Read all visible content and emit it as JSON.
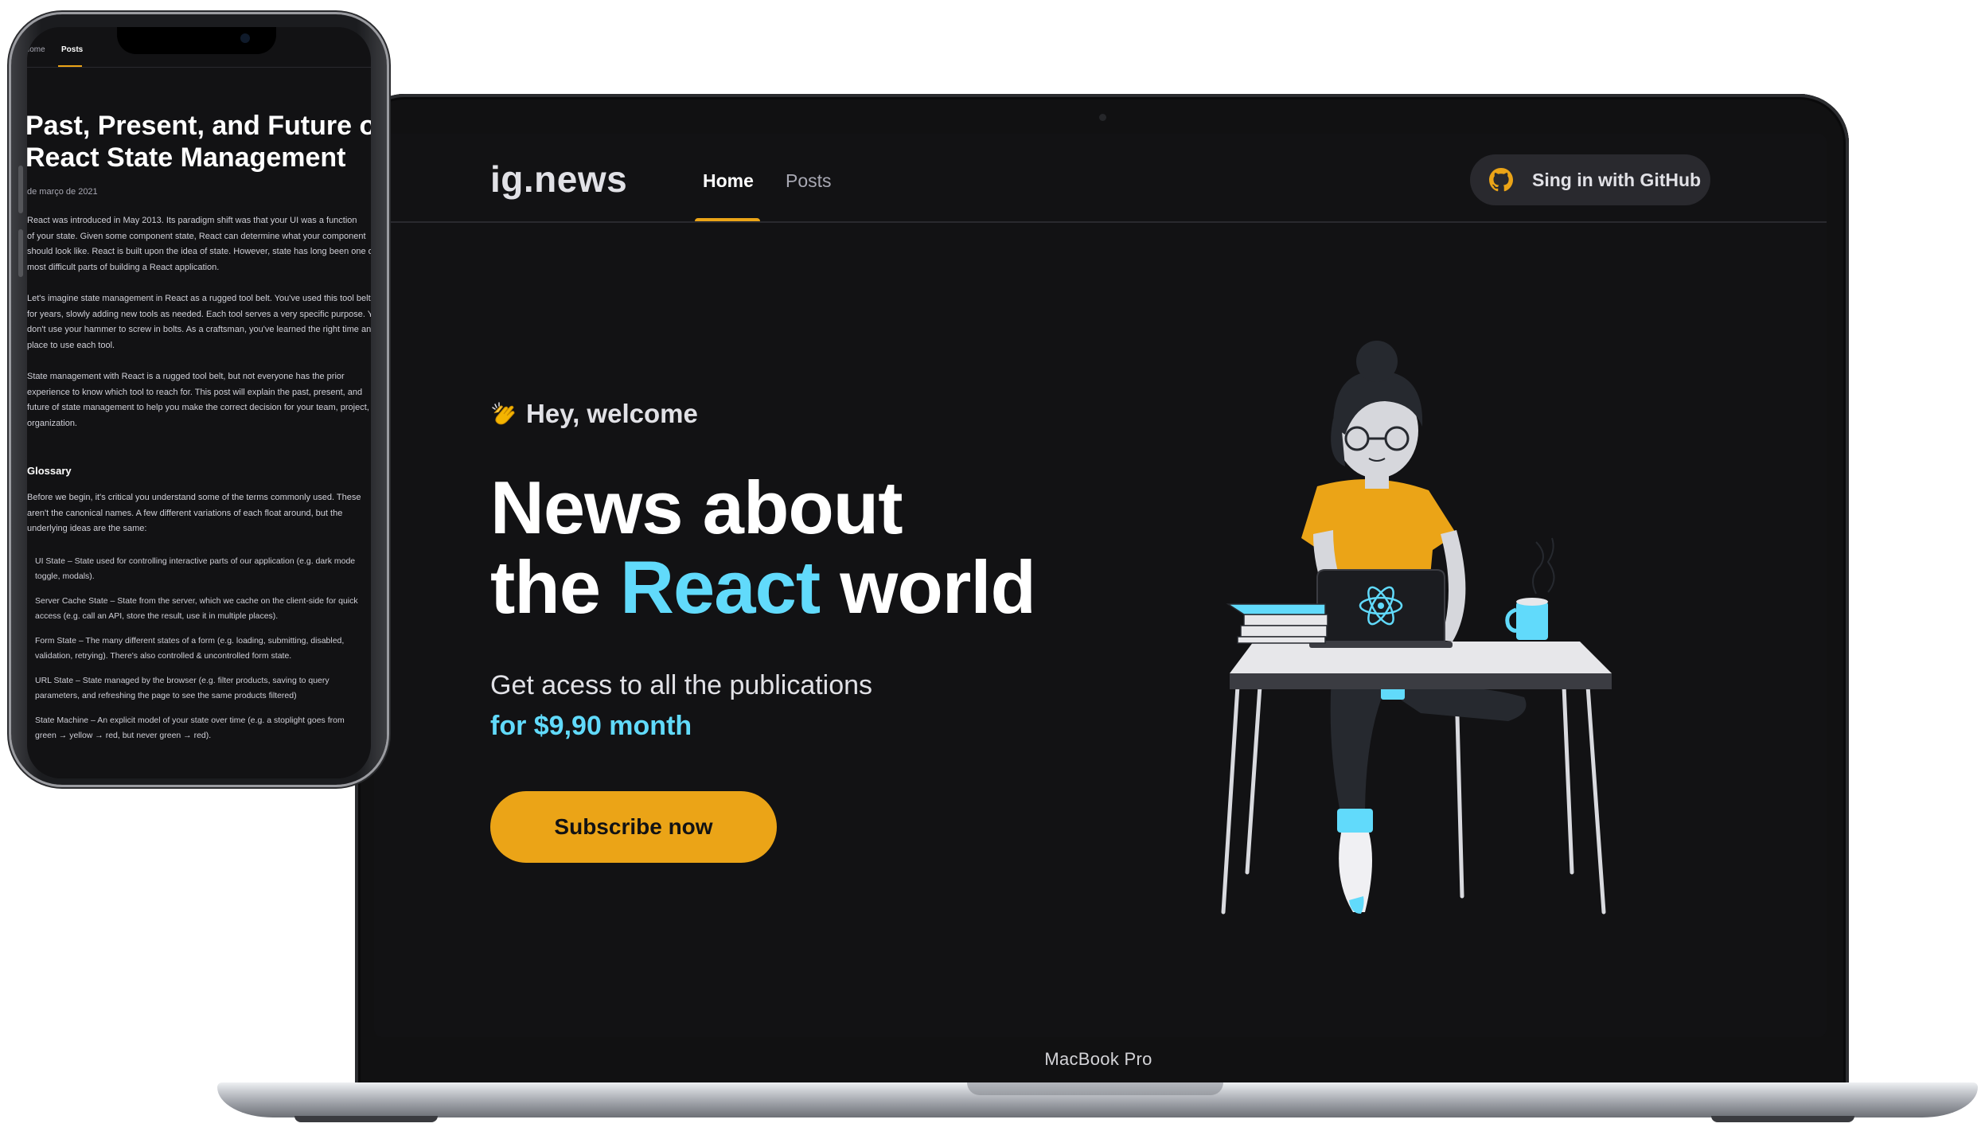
{
  "laptop": {
    "brand_label": "MacBook Pro",
    "site": {
      "logo": "ig.news",
      "nav": [
        {
          "label": "Home",
          "active": true
        },
        {
          "label": "Posts",
          "active": false
        }
      ],
      "github_button": {
        "label": "Sing in with GitHub",
        "icon": "github-icon"
      },
      "hero": {
        "greeting": "Hey, welcome",
        "greeting_icon": "clapping-hands-icon",
        "title_line1": "News about",
        "title_line2_pre": "the ",
        "title_line2_accent": "React",
        "title_line2_post": " world",
        "subtitle": "Get acess to all the publications",
        "price": "for $9,90 month",
        "cta": "Subscribe now"
      }
    }
  },
  "phone": {
    "nav": [
      {
        "label": "Home",
        "active": false
      },
      {
        "label": "Posts",
        "active": true
      }
    ],
    "post": {
      "title_line1": "Past, Present, and Future of",
      "title_line2": "React State Management",
      "date": "de março de 2021",
      "paragraphs": [
        [
          "React was introduced in May 2013. Its paradigm shift was that your UI was a function",
          "of your state. Given some component state, React can determine what your component",
          "should look like. React is built upon the idea of state. However, state has long been one of the",
          "most difficult parts of building a React application."
        ],
        [
          "Let's imagine state management in React as a rugged tool belt. You've used this tool belt",
          "for years, slowly adding new tools as needed. Each tool serves a very specific purpose. You",
          "don't use your hammer to screw in bolts. As a craftsman, you've learned the right time and",
          "place to use each tool."
        ],
        [
          "State management with React is a rugged tool belt, but not everyone has the prior",
          "experience to know which tool to reach for. This post will explain the past, present, and",
          "future of state management to help you make the correct decision for your team, project, and",
          "organization."
        ]
      ],
      "glossary_heading": "Glossary",
      "glossary_intro": [
        "Before we begin, it's critical you understand some of the terms commonly used. These",
        "aren't the canonical names. A few different variations of each float around, but the",
        "underlying ideas are the same:"
      ],
      "glossary_items": [
        [
          "UI State – State used for controlling interactive parts of our application (e.g. dark mode",
          "toggle, modals)."
        ],
        [
          "Server Cache State – State from the server, which we cache on the client-side for quick",
          "access (e.g. call an API, store the result, use it in multiple places)."
        ],
        [
          "Form State – The many different states of a form (e.g. loading, submitting, disabled,",
          "validation, retrying). There's also controlled & uncontrolled form state."
        ],
        [
          "URL State – State managed by the browser (e.g. filter products, saving to query",
          "parameters, and refreshing the page to see the same products filtered)"
        ],
        [
          "State Machine – An explicit model of your state over time (e.g. a stoplight goes from",
          "green → yellow → red, but never green → red)."
        ]
      ]
    }
  },
  "colors": {
    "background": "#121214",
    "accent_yellow": "#eba417",
    "accent_cyan": "#61dafb",
    "text": "#e1e1e6",
    "muted": "#a8a8b3"
  }
}
